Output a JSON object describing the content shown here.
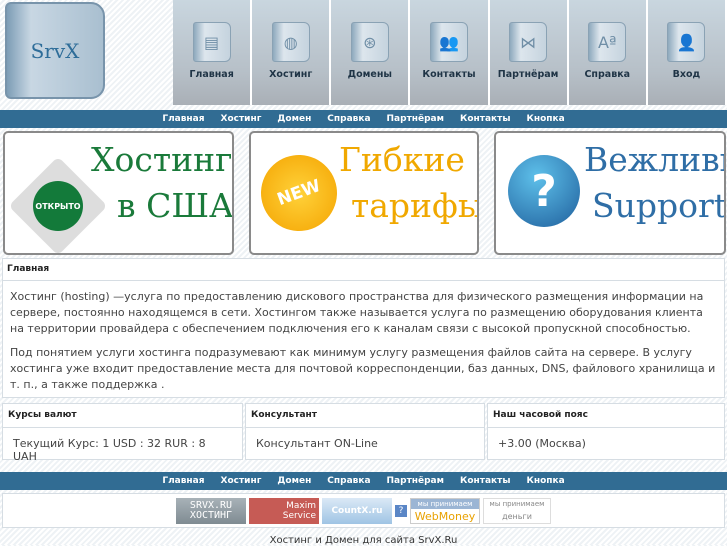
{
  "logo": {
    "text": "SrvX"
  },
  "top_nav": [
    {
      "label": "Главная",
      "icon": "document-icon",
      "glyph": "▤"
    },
    {
      "label": "Хостинг",
      "icon": "globe-icon",
      "glyph": "◍"
    },
    {
      "label": "Домены",
      "icon": "www-icon",
      "glyph": "⊛"
    },
    {
      "label": "Контакты",
      "icon": "people-icon",
      "glyph": "👥"
    },
    {
      "label": "Партнёрам",
      "icon": "network-icon",
      "glyph": "⋈"
    },
    {
      "label": "Справка",
      "icon": "font-icon",
      "glyph": "Aª"
    },
    {
      "label": "Вход",
      "icon": "user-icon",
      "glyph": "👤"
    }
  ],
  "nav": [
    "Главная",
    "Хостинг",
    "Домен",
    "Справка",
    "Партнёрам",
    "Контакты",
    "Кнопка"
  ],
  "banners": [
    {
      "line1": "Хостинг",
      "line2": "в США",
      "badge": "ОТКРЫТО",
      "color": "#1a7a3a"
    },
    {
      "line1": "Гибкие",
      "line2": "тарифы",
      "badge": "NEW",
      "color": "#f0a800"
    },
    {
      "line1": "Вежливый",
      "line2": "Support",
      "badge": "?",
      "color": "#2f6ea6"
    }
  ],
  "content": {
    "title": "Главная",
    "p1": "Хостинг (hosting) —услуга по предоставлению дискового пространства для физического размещения информации на сервере, постоянно находящемся в сети. Хостингом также называется услуга по размещению оборудования клиента на территории провайдера с обеспечением подключения его к каналам связи с высокой пропускной способностью.",
    "p2": "Под понятием услуги хостинга подразумевают как минимум услугу размещения файлов сайта на сервере. В услугу хостинга уже входит предоставление места для почтовой корреспонденции, баз данных, DNS, файлового хранилища и т. п., а также поддержка ."
  },
  "info": [
    {
      "title": "Курсы валют",
      "value": "Текущий Курс: 1 USD : 32 RUR : 8 UAH"
    },
    {
      "title": "Консультант",
      "value": "Консультант ON-Line"
    },
    {
      "title": "Наш часовой пояс",
      "value": "+3.00 (Москва)"
    }
  ],
  "buttons": {
    "srvx1": "SRVX.RU",
    "srvx2": "ХОСТИНГ",
    "maxim1": "Maxim",
    "maxim2": "Service",
    "countx": "CountX.ru",
    "q": "?",
    "wm_top": "мы принимаем",
    "wm": "WebMoney",
    "ya_top": "мы принимаем",
    "ya": "деньги"
  },
  "footer": "Хостинг и Домен для сайта SrvX.Ru"
}
